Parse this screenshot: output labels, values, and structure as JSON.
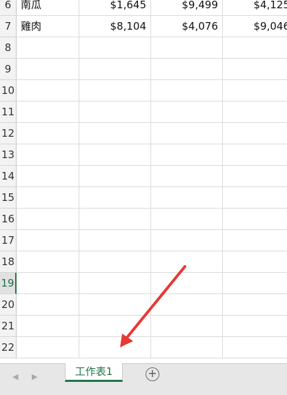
{
  "rows": [
    {
      "num": "6",
      "name": "南瓜",
      "b": "$1,645",
      "c": "$9,499",
      "d": "$4,125"
    },
    {
      "num": "7",
      "name": "雞肉",
      "b": "$8,104",
      "c": "$4,076",
      "d": "$9,046"
    },
    {
      "num": "8",
      "name": "",
      "b": "",
      "c": "",
      "d": ""
    },
    {
      "num": "9",
      "name": "",
      "b": "",
      "c": "",
      "d": ""
    },
    {
      "num": "10",
      "name": "",
      "b": "",
      "c": "",
      "d": ""
    },
    {
      "num": "11",
      "name": "",
      "b": "",
      "c": "",
      "d": ""
    },
    {
      "num": "12",
      "name": "",
      "b": "",
      "c": "",
      "d": ""
    },
    {
      "num": "13",
      "name": "",
      "b": "",
      "c": "",
      "d": ""
    },
    {
      "num": "14",
      "name": "",
      "b": "",
      "c": "",
      "d": ""
    },
    {
      "num": "15",
      "name": "",
      "b": "",
      "c": "",
      "d": ""
    },
    {
      "num": "16",
      "name": "",
      "b": "",
      "c": "",
      "d": ""
    },
    {
      "num": "17",
      "name": "",
      "b": "",
      "c": "",
      "d": ""
    },
    {
      "num": "18",
      "name": "",
      "b": "",
      "c": "",
      "d": ""
    },
    {
      "num": "19",
      "name": "",
      "b": "",
      "c": "",
      "d": ""
    },
    {
      "num": "20",
      "name": "",
      "b": "",
      "c": "",
      "d": ""
    },
    {
      "num": "21",
      "name": "",
      "b": "",
      "c": "",
      "d": ""
    },
    {
      "num": "22",
      "name": "",
      "b": "",
      "c": "",
      "d": ""
    }
  ],
  "selected_row": "19",
  "sheet_tab": {
    "label": "工作表1"
  },
  "nav": {
    "prev_icon": "◀",
    "next_icon": "▶"
  },
  "add_sheet": {
    "icon": "+"
  },
  "annotation": {
    "color": "#e53935"
  },
  "accent_color": "#217346"
}
